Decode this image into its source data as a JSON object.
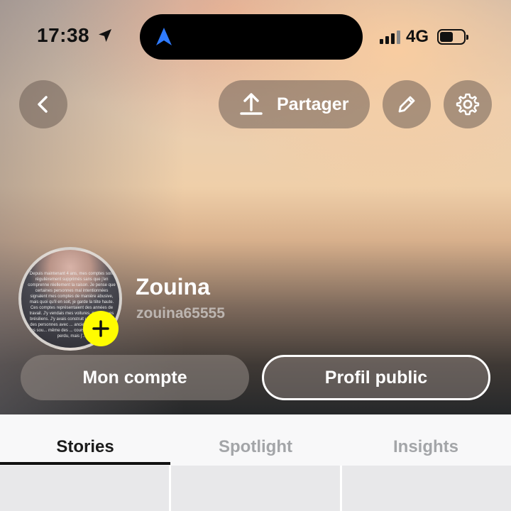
{
  "status_bar": {
    "time": "17:38",
    "network": "4G",
    "battery_level": 0.5,
    "location_active": true
  },
  "header": {
    "share_label": "Partager"
  },
  "profile": {
    "display_name": "Zouina",
    "username": "zouina65555",
    "avatar_text": "Depuis maintenant 4 ans, mes comptes sont régulièrement supprimés sans que j'en comprenne réellement la raison. Je pense que certaines personnes mal intentionnées signalent mes comptes de manière abusive, mais quoi qu'il en soit, je garde la tête haute. Ces comptes représentaient des années de travail. J'y vendais mes voitures, mes tenues brésiliens. J'y avais construit une ... retrouvé des personnes avec ... anciens professeurs, des sou... même des ... cours que j'avais co... perdu, mais j'..."
  },
  "actions": {
    "account_label": "Mon compte",
    "public_profile_label": "Profil public"
  },
  "tabs": [
    {
      "label": "Stories",
      "active": true
    },
    {
      "label": "Spotlight",
      "active": false
    },
    {
      "label": "Insights",
      "active": false
    }
  ],
  "colors": {
    "snap_yellow": "#fffc00",
    "nav_blue": "#2f7bff"
  }
}
